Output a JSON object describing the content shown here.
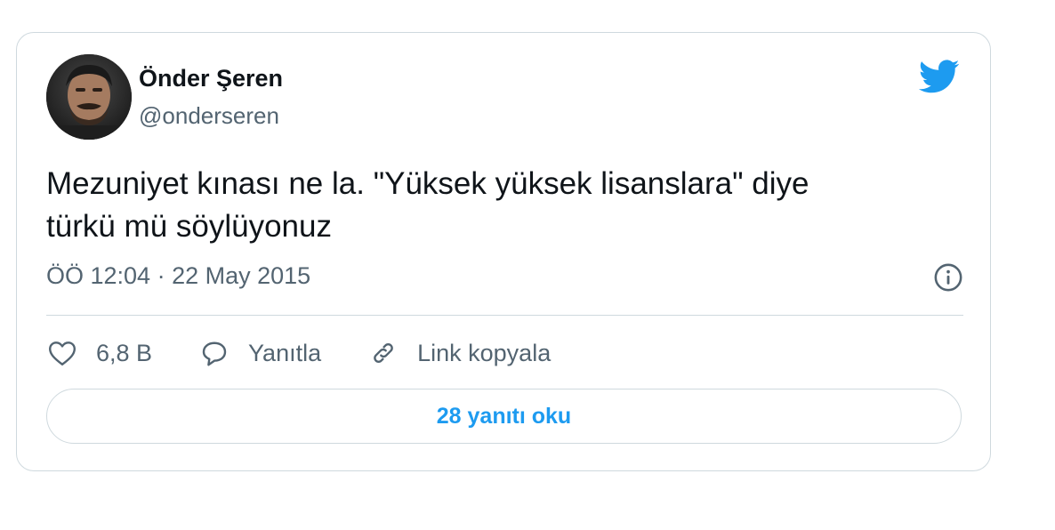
{
  "tweet": {
    "author": {
      "display_name": "Önder Şeren",
      "handle": "@onderseren",
      "avatar_icon": "profile-photo"
    },
    "text_lines": [
      "Mezuniyet kınası ne la. \"Yüksek yüksek lisanslara\" diye",
      "türkü mü söylüyonuz"
    ],
    "timestamp": "ÖÖ 12:04 · 22 May 2015",
    "actions": {
      "like_count": "6,8 B",
      "reply_label": "Yanıtla",
      "copy_link_label": "Link kopyala"
    },
    "read_replies_label": "28 yanıtı oku",
    "icons": {
      "brand": "twitter-bird-icon",
      "info": "info-icon",
      "like": "heart-icon",
      "reply": "speech-bubble-icon",
      "link": "link-icon"
    }
  },
  "colors": {
    "accent": "#1d9bf0",
    "text": "#0f1419",
    "secondary_text": "#536471",
    "border": "#cfd9de"
  }
}
